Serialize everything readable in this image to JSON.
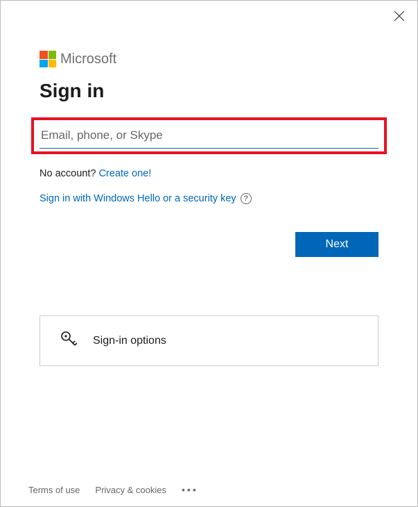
{
  "brand": {
    "name": "Microsoft"
  },
  "heading": "Sign in",
  "identity_input": {
    "placeholder": "Email, phone, or Skype",
    "value": ""
  },
  "no_account": {
    "prompt": "No account?",
    "link": "Create one!"
  },
  "security_link": "Sign in with Windows Hello or a security key",
  "next_button": "Next",
  "signin_options": "Sign-in options",
  "footer": {
    "terms": "Terms of use",
    "privacy": "Privacy & cookies"
  }
}
